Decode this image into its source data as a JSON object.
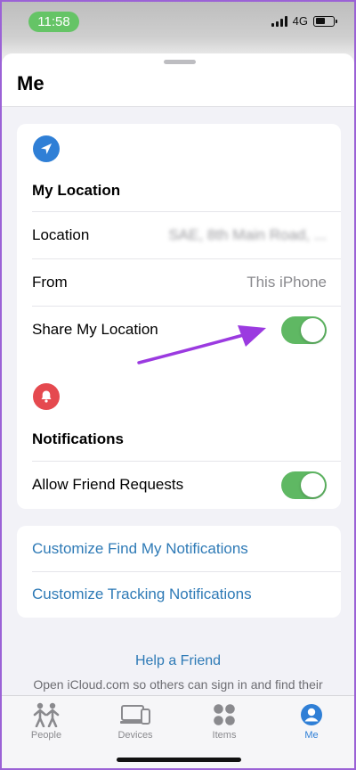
{
  "status": {
    "time": "11:58",
    "network": "4G"
  },
  "header": {
    "title": "Me"
  },
  "location_section": {
    "title": "My Location",
    "rows": [
      {
        "label": "Location",
        "value": "SAE, 8th Main Road, ..."
      },
      {
        "label": "From",
        "value": "This iPhone"
      },
      {
        "label": "Share My Location",
        "toggle": true
      }
    ]
  },
  "notifications_section": {
    "title": "Notifications",
    "rows": [
      {
        "label": "Allow Friend Requests",
        "toggle": true
      }
    ]
  },
  "links": [
    {
      "label": "Customize Find My Notifications"
    },
    {
      "label": "Customize Tracking Notifications"
    }
  ],
  "help": {
    "title": "Help a Friend",
    "text": "Open iCloud.com so others can sign in and find their"
  },
  "tabs": [
    {
      "label": "People",
      "icon": "people-icon",
      "active": false
    },
    {
      "label": "Devices",
      "icon": "devices-icon",
      "active": false
    },
    {
      "label": "Items",
      "icon": "items-icon",
      "active": false
    },
    {
      "label": "Me",
      "icon": "me-icon",
      "active": true
    }
  ],
  "colors": {
    "toggle_on": "#5fb863",
    "link": "#2e7ab6",
    "location_icon_bg": "#2f7fd6",
    "notification_icon_bg": "#e5494f",
    "active_tab": "#2f7fd6",
    "annotation_arrow": "#9b3ae0"
  }
}
